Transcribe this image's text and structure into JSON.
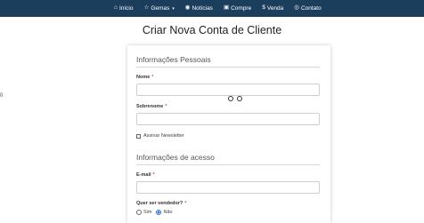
{
  "nav": {
    "items": [
      {
        "label": "Início",
        "icon": "home-icon",
        "glyph": "⌂"
      },
      {
        "label": "Gemas",
        "icon": "star-icon",
        "glyph": "☆",
        "caret": "▾"
      },
      {
        "label": "Notícias",
        "icon": "globe-icon",
        "glyph": "◉"
      },
      {
        "label": "Compre",
        "icon": "shopping-bag-icon",
        "glyph": "▣"
      },
      {
        "label": "Venda",
        "icon": "dollar-icon",
        "glyph": "$"
      },
      {
        "label": "Contato",
        "icon": "whatsapp-icon",
        "glyph": "◎"
      }
    ]
  },
  "page": {
    "title": "Criar Nova Conta de Cliente",
    "side_mark": "0"
  },
  "personal": {
    "title": "Informações Pessoais",
    "first_name_label": "Nome",
    "first_name_value": "",
    "last_name_label": "Sobrenome",
    "last_name_value": "",
    "newsletter_label": "Assinar Newsletter",
    "newsletter_checked": false,
    "required_mark": "*"
  },
  "access": {
    "title": "Informações de acesso",
    "email_label": "E-mail",
    "email_value": "",
    "seller_label": "Quer ser vendedor?",
    "seller_options": [
      "Sim",
      "Não"
    ],
    "seller_selected": "Não"
  },
  "colors": {
    "navbar": "#1c3e5d",
    "required": "#d9534f",
    "radio_accent": "#2b6fd6"
  }
}
